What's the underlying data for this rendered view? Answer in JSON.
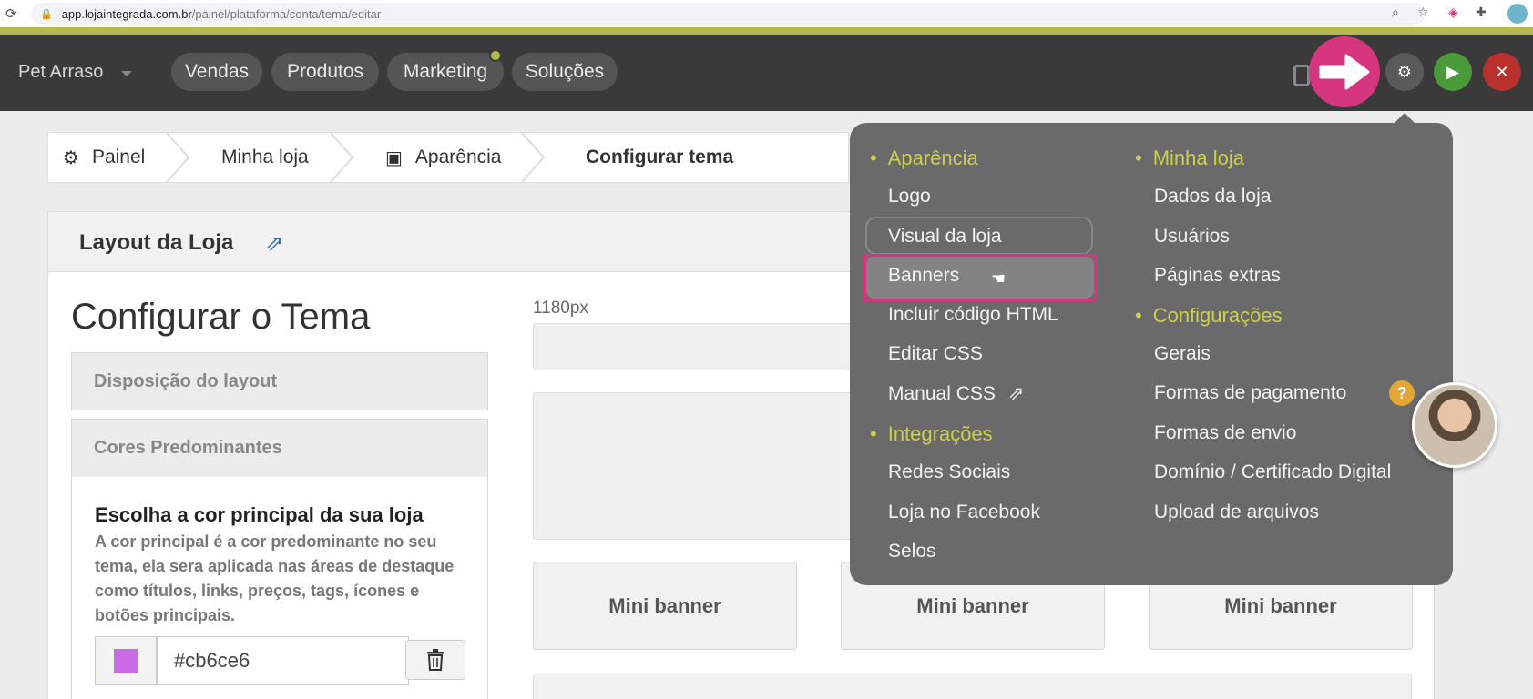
{
  "browser": {
    "url_host": "app.lojaintegrada.com.br",
    "url_path": "/painel/plataforma/conta/tema/editar"
  },
  "appbar": {
    "store_name": "Pet Arraso",
    "nav": [
      {
        "label": "Vendas"
      },
      {
        "label": "Produtos"
      },
      {
        "label": "Marketing"
      },
      {
        "label": "Soluções"
      }
    ]
  },
  "breadcrumb": {
    "items": [
      {
        "label": "Painel",
        "icon": "gear-icon"
      },
      {
        "label": "Minha loja"
      },
      {
        "label": "Aparência",
        "icon": "window-icon"
      },
      {
        "label": "Configurar tema"
      }
    ]
  },
  "panel": {
    "title": "Layout da Loja",
    "theme_title": "Configurar o Tema",
    "accordion": [
      {
        "label": "Disposição do layout"
      },
      {
        "label": "Cores Predominantes"
      }
    ],
    "color_heading": "Escolha a cor principal da sua loja",
    "color_description": "A cor principal é a cor predominante no seu tema, ela sera aplicada nas áreas de destaque como títulos, links, preços, tags, ícones e botões principais.",
    "color_value": "#cb6ce6",
    "preview_width_label": "1180px",
    "mini_banners": [
      "Mini banner",
      "Mini banner",
      "Mini banner"
    ]
  },
  "menu": {
    "col1": [
      {
        "type": "head",
        "label": "Aparência"
      },
      {
        "type": "item",
        "label": "Logo"
      },
      {
        "type": "item",
        "label": "Visual da loja"
      },
      {
        "type": "item",
        "label": "Banners"
      },
      {
        "type": "item",
        "label": "Incluir código HTML"
      },
      {
        "type": "item",
        "label": "Editar CSS"
      },
      {
        "type": "item",
        "label": "Manual CSS"
      },
      {
        "type": "head",
        "label": "Integrações"
      },
      {
        "type": "item",
        "label": "Redes Sociais"
      },
      {
        "type": "item",
        "label": "Loja no Facebook"
      },
      {
        "type": "item",
        "label": "Selos"
      }
    ],
    "col2": [
      {
        "type": "head",
        "label": "Minha loja"
      },
      {
        "type": "item",
        "label": "Dados da loja"
      },
      {
        "type": "item",
        "label": "Usuários"
      },
      {
        "type": "item",
        "label": "Páginas extras"
      },
      {
        "type": "head",
        "label": "Configurações"
      },
      {
        "type": "item",
        "label": "Gerais"
      },
      {
        "type": "item",
        "label": "Formas de pagamento"
      },
      {
        "type": "item",
        "label": "Formas de envio"
      },
      {
        "type": "item",
        "label": "Domínio / Certificado Digital"
      },
      {
        "type": "item",
        "label": "Upload de arquivos"
      }
    ],
    "help_label": "?"
  },
  "colors": {
    "accent_green": "#cbd04f",
    "highlight_pink": "#d6367d",
    "appbar_bg": "#3a3a3a"
  }
}
